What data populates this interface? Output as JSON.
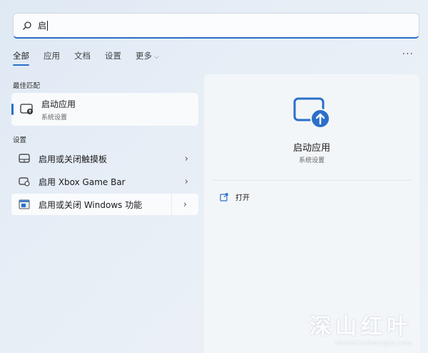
{
  "search": {
    "value": "启"
  },
  "tabs": [
    {
      "label": "全部",
      "active": true
    },
    {
      "label": "应用"
    },
    {
      "label": "文档"
    },
    {
      "label": "设置"
    },
    {
      "label": "更多"
    }
  ],
  "more_menu": "···",
  "best_match": {
    "section": "最佳匹配",
    "title": "启动应用",
    "subtitle": "系统设置",
    "icon": "startup-apps-icon"
  },
  "settings": {
    "section": "设置",
    "items": [
      {
        "label": "启用或关闭触摸板",
        "icon": "touchpad-icon"
      },
      {
        "label": "启用 Xbox Game Bar",
        "icon": "game-bar-icon"
      },
      {
        "label": "启用或关闭 Windows 功能",
        "icon": "windows-features-icon"
      }
    ]
  },
  "detail": {
    "title": "启动应用",
    "subtitle": "系统设置",
    "open_label": "打开"
  },
  "watermark": {
    "big": "深山红叶",
    "small": "shenshanhongye.com"
  },
  "colors": {
    "accent": "#2a6fc9",
    "background": "#e7eef6"
  }
}
